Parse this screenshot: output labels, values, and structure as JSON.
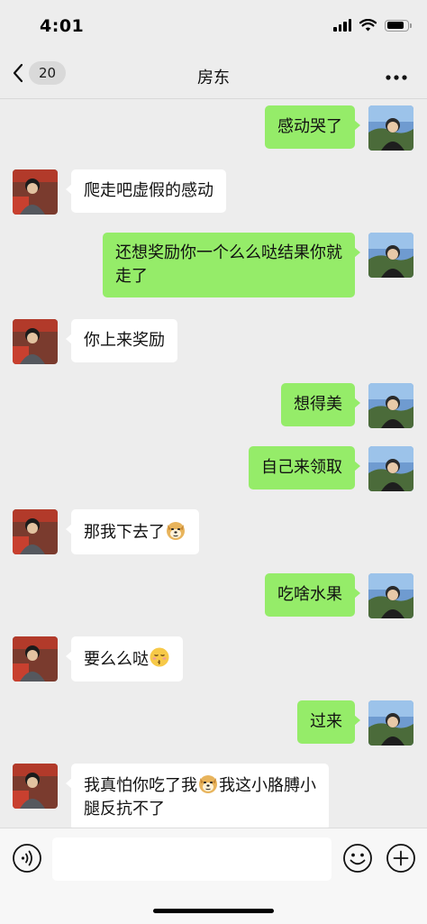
{
  "status_bar": {
    "time": "4:01"
  },
  "nav": {
    "back_count": "20",
    "title": "房东"
  },
  "messages": [
    {
      "side": "right",
      "text": "感动哭了"
    },
    {
      "side": "left",
      "text": "爬走吧虚假的感动"
    },
    {
      "side": "right",
      "text_line1": "还想奖励你一个么么哒结果你就",
      "text_line2": "走了"
    },
    {
      "side": "left",
      "text": "你上来奖励"
    },
    {
      "side": "right",
      "text": "想得美"
    },
    {
      "side": "right",
      "text": "自己来领取"
    },
    {
      "side": "left",
      "text": "那我下去了",
      "emoji": "doge-emoji"
    },
    {
      "side": "right",
      "text": "吃啥水果"
    },
    {
      "side": "left",
      "text": "要么么哒",
      "emoji": "kissing-emoji"
    },
    {
      "side": "right",
      "text": "过来"
    },
    {
      "side": "left",
      "text_a": "我真怕你吃了我",
      "emoji": "doge-emoji",
      "text_b": "我这小胳膊小",
      "text_line2": "腿反抗不了"
    }
  ],
  "input": {
    "value": "",
    "placeholder": ""
  },
  "colors": {
    "bubble_sent": "#95ec69",
    "bubble_received": "#ffffff",
    "background": "#ededed"
  }
}
